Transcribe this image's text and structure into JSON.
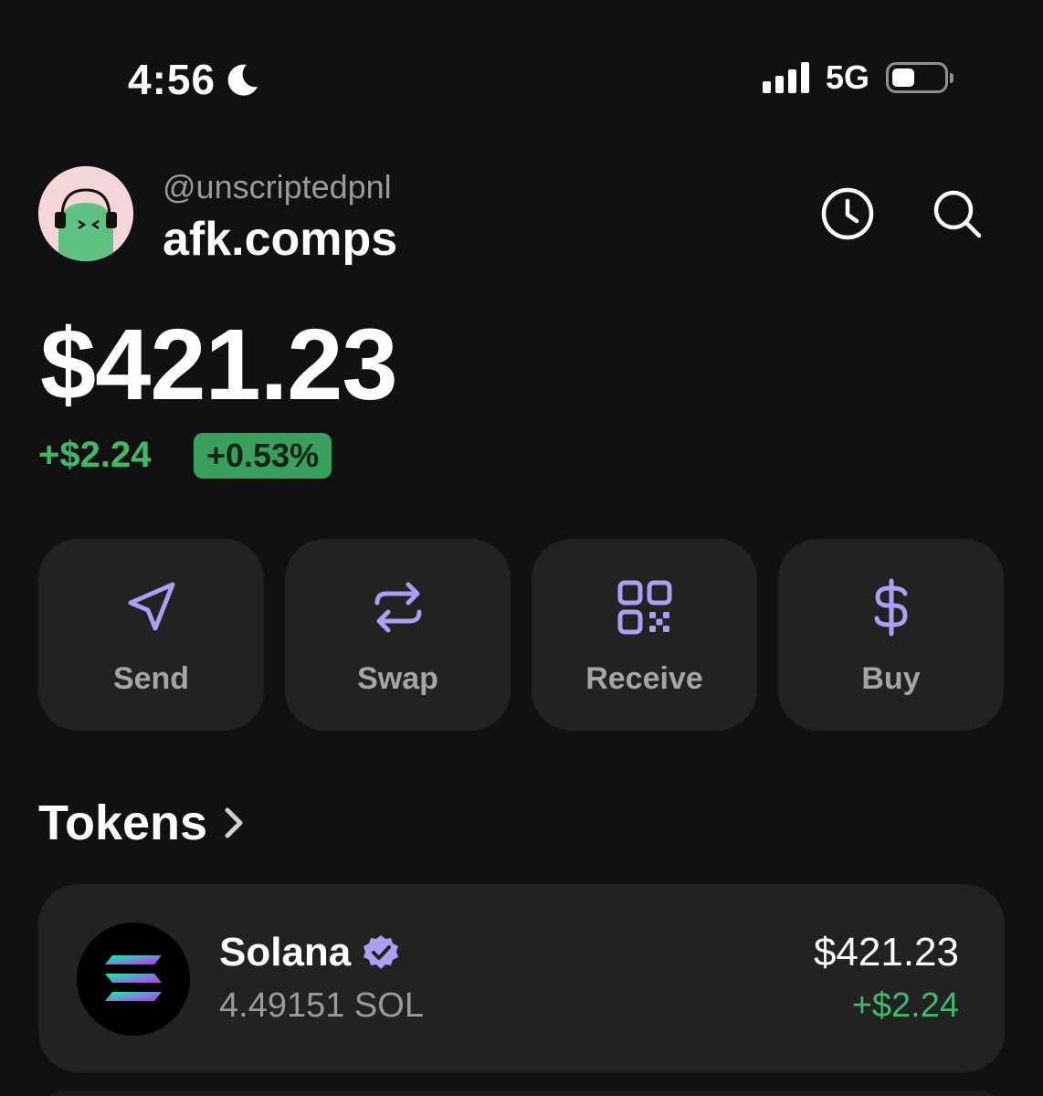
{
  "status_bar": {
    "time": "4:56",
    "network": "5G",
    "battery_level_fraction": 0.45,
    "signal_bars": 4,
    "icons": [
      "moon-icon",
      "signal-icon",
      "battery-icon"
    ]
  },
  "header": {
    "handle": "@unscriptedpnl",
    "account_name": "afk.comps",
    "icons": [
      "history-clock-icon",
      "search-icon"
    ]
  },
  "balance": {
    "total": "$421.23",
    "change_amount": "+$2.24",
    "change_percent": "+0.53%"
  },
  "actions": [
    {
      "label": "Send",
      "icon": "send-icon"
    },
    {
      "label": "Swap",
      "icon": "swap-icon"
    },
    {
      "label": "Receive",
      "icon": "qr-code-icon"
    },
    {
      "label": "Buy",
      "icon": "dollar-icon"
    }
  ],
  "tokens": {
    "title": "Tokens",
    "items": [
      {
        "name": "Solana",
        "quantity": "4.49151 SOL",
        "value": "$421.23",
        "change": "+$2.24",
        "verified": true
      }
    ]
  },
  "colors": {
    "background": "#111111",
    "card": "#222222",
    "accent": "#ab9ff2",
    "positive": "#3fb868",
    "badge_bg": "#3a9f5d"
  }
}
